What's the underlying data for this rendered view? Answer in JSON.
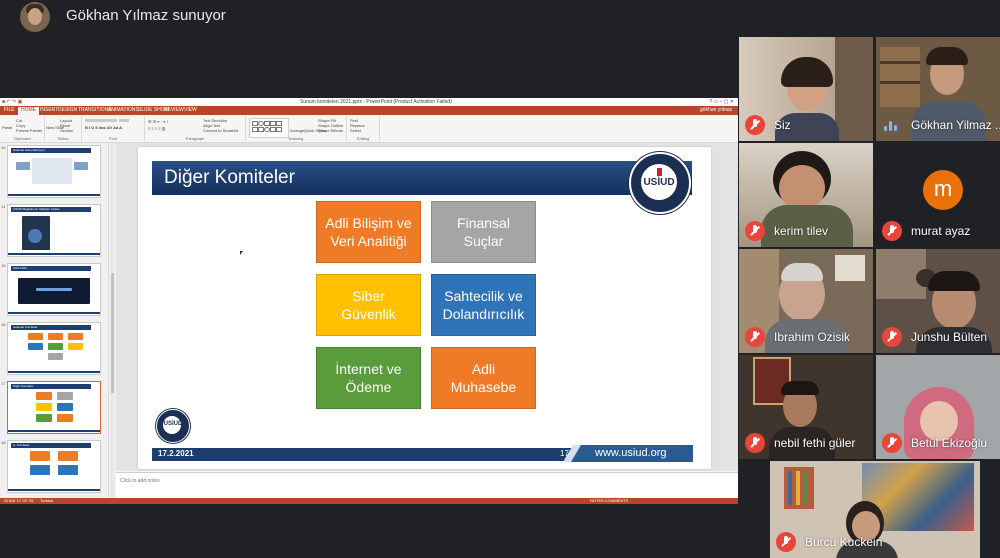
{
  "presenter": {
    "label": "Gökhan Yılmaz sunuyor"
  },
  "powerpoint": {
    "window_title": "Sunum komiteleri 2021.pptx - PowerPoint (Product Activation Failed)",
    "tabs": [
      "FILE",
      "HOME",
      "INSERT",
      "DESIGN",
      "TRANSITIONS",
      "ANIMATIONS",
      "SLIDE SHOW",
      "REVIEW",
      "VIEW"
    ],
    "active_tab": "HOME",
    "user": "gökhan yılmaz",
    "notes_placeholder": "Click to add notes",
    "status_left": "SLIDE 17 OF 25",
    "status_lang": "Turkish",
    "status_right": "NOTES    COMMENTS",
    "ribbon": {
      "paste": "Paste",
      "cut": "Cut",
      "copy": "Copy",
      "format_painter": "Format Painter",
      "new_slide": "New Slide",
      "layout": "Layout",
      "reset": "Reset",
      "section": "Section",
      "text_direction": "Text Direction",
      "align_text": "Align Text",
      "convert_smartart": "Convert to SmartArt",
      "arrange": "Arrange",
      "quick_styles": "Quick Styles",
      "shape_fill": "Shape Fill",
      "shape_outline": "Shape Outline",
      "shape_effects": "Shape Effects",
      "find": "Find",
      "replace": "Replace",
      "select": "Select",
      "groups": [
        "Clipboard",
        "Slides",
        "Font",
        "Paragraph",
        "Drawing",
        "Editing"
      ]
    },
    "thumbnails": [
      {
        "number": "13",
        "title": "Gelecek Sunumlar(ıyor)"
      },
      {
        "number": "14",
        "title": "USİUD Başkanının Takipleri Listesi"
      },
      {
        "number": "15",
        "title": "Ödül 2021"
      },
      {
        "number": "16",
        "title": "Gelecek Komiteler"
      },
      {
        "number": "17",
        "title": "Diğer Komiteler"
      },
      {
        "number": "18",
        "title": "Ç. Komiteler"
      }
    ]
  },
  "slide": {
    "title": "Diğer Komiteler",
    "logo_text": "USİUD",
    "boxes": [
      {
        "line1": "Adli Bilişim ve",
        "line2": "Veri Analitiği",
        "color": "#f07b26"
      },
      {
        "line1": "Finansal",
        "line2": "Suçlar",
        "color": "#a5a5a5"
      },
      {
        "line1": "Siber",
        "line2": "Güvenlik",
        "color": "#ffc000"
      },
      {
        "line1": "Sahtecilik ve",
        "line2": "Dolandırıcılık",
        "color": "#2f73b8"
      },
      {
        "line1": "İnternet ve",
        "line2": "Ödeme",
        "color": "#5a9b3b"
      },
      {
        "line1": "Adli",
        "line2": "Muhasebe",
        "color": "#f07b26"
      }
    ],
    "footer_date": "17.2.2021",
    "page_number": "17",
    "website": "www.usiud.org"
  },
  "participants": [
    {
      "name": "Siz",
      "muted": true
    },
    {
      "name": "Gökhan Yilmaz ...",
      "muted": false,
      "speaking": true
    },
    {
      "name": "kerim tilev",
      "muted": true
    },
    {
      "name": "murat ayaz",
      "muted": true,
      "avatar_letter": "m"
    },
    {
      "name": "Ibrahim Ozisik",
      "muted": true
    },
    {
      "name": "Junshu Bülten",
      "muted": true
    },
    {
      "name": "nebil fethi güler",
      "muted": true
    },
    {
      "name": "Betül Ekizoğlu",
      "muted": true
    },
    {
      "name": "Burcu Kuckein",
      "muted": true
    }
  ],
  "colors": {
    "meet_background": "#202124",
    "powerpoint_accent": "#b7472a",
    "mute_red": "#e9453b",
    "slide_navy": "#1d3e6c"
  }
}
